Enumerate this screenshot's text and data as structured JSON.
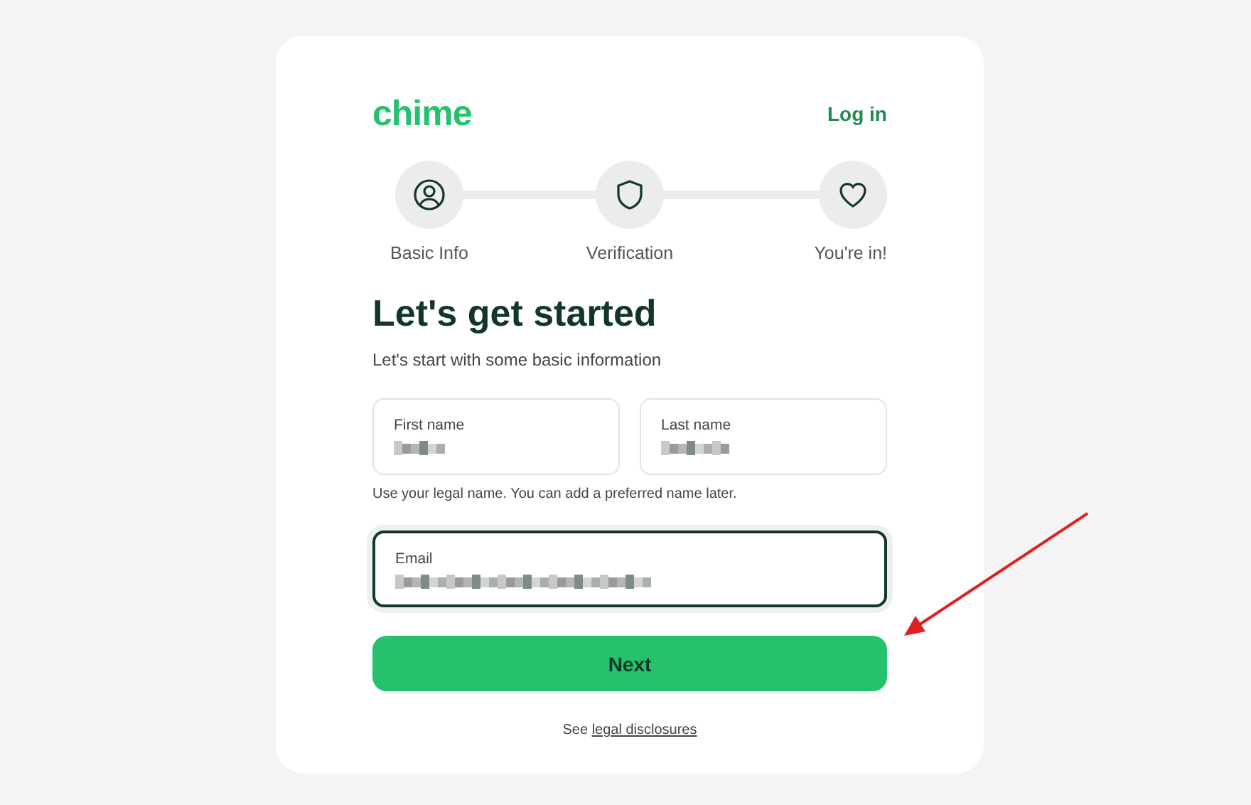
{
  "header": {
    "logo": "chime",
    "login_link": "Log in"
  },
  "steps": [
    {
      "label": "Basic Info",
      "kind": "person"
    },
    {
      "label": "Verification",
      "kind": "shield"
    },
    {
      "label": "You're in!",
      "kind": "heart"
    }
  ],
  "title": "Let's get started",
  "subtitle": "Let's start with some basic information",
  "name_fields": [
    {
      "label": "First name",
      "value_blurred": true,
      "focused": false
    },
    {
      "label": "Last name",
      "value_blurred": true,
      "focused": false
    }
  ],
  "name_hint": "Use your legal name. You can add a preferred name later.",
  "email_field": {
    "label": "Email",
    "value_blurred": true,
    "focused": true
  },
  "next_button": "Next",
  "footer": {
    "prefix": "See",
    "link": "legal disclosures"
  },
  "annotation": {
    "kind": "arrow"
  }
}
